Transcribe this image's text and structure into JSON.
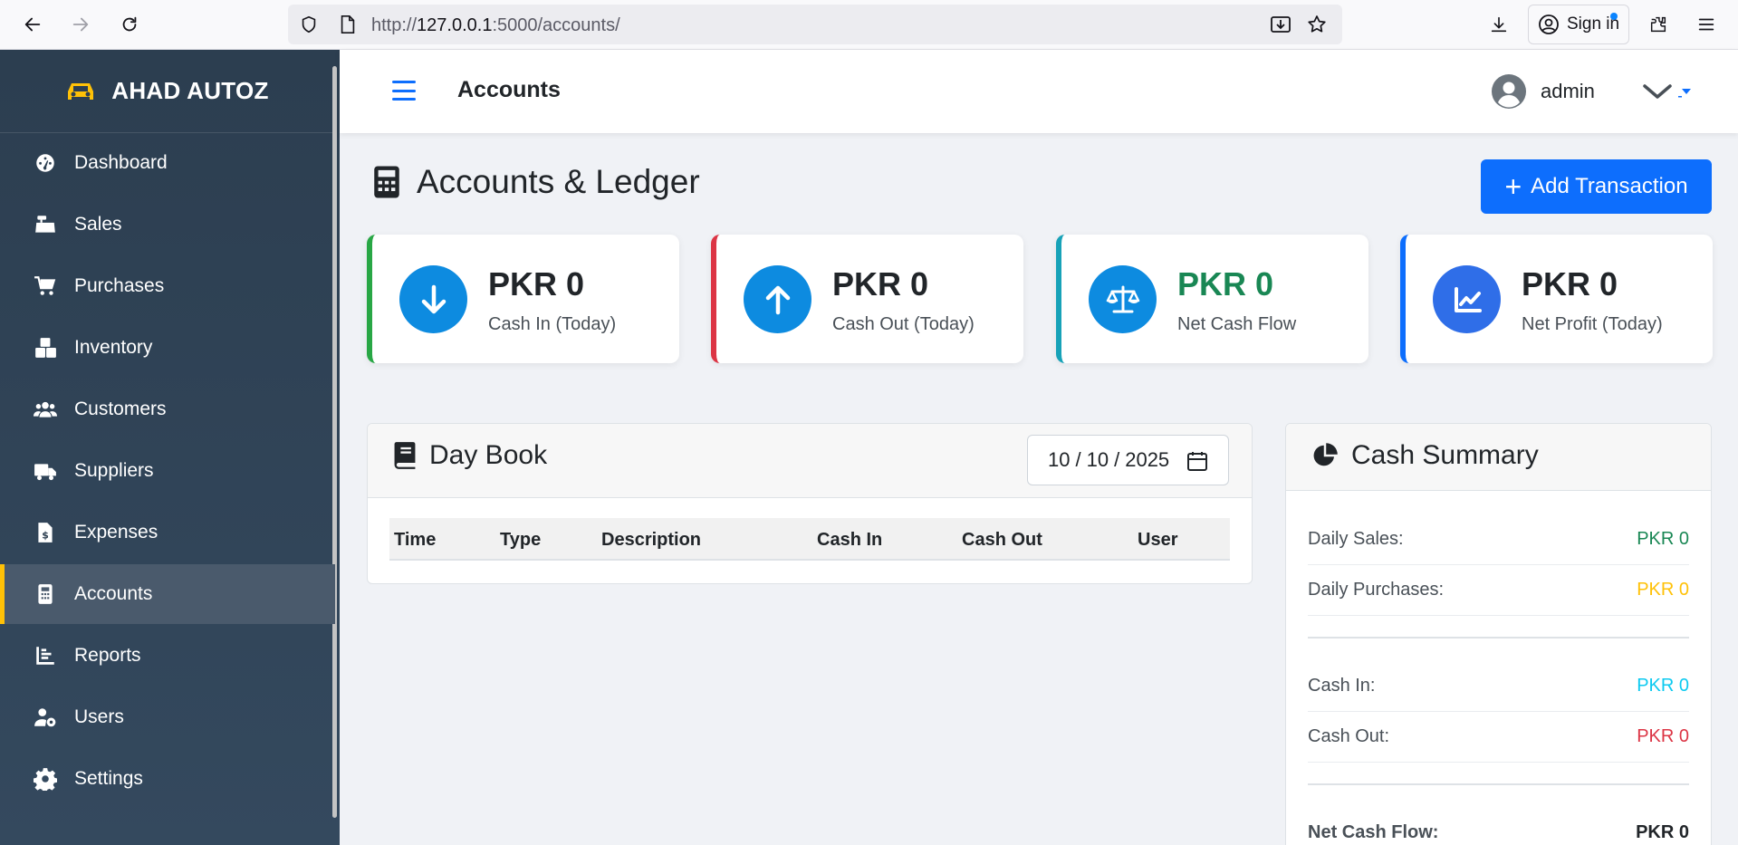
{
  "browser": {
    "url_prefix": "http://",
    "url_host": "127.0.0.1",
    "url_rest": ":5000/accounts/",
    "sign_in_label": "Sign in"
  },
  "sidebar": {
    "brand": "AHAD AUTOZ",
    "items": [
      {
        "label": "Dashboard",
        "icon": "dashboard-gauge-icon"
      },
      {
        "label": "Sales",
        "icon": "cash-register-icon"
      },
      {
        "label": "Purchases",
        "icon": "cart-icon"
      },
      {
        "label": "Inventory",
        "icon": "boxes-icon"
      },
      {
        "label": "Customers",
        "icon": "users-icon"
      },
      {
        "label": "Suppliers",
        "icon": "truck-icon"
      },
      {
        "label": "Expenses",
        "icon": "invoice-dollar-icon"
      },
      {
        "label": "Accounts",
        "icon": "calculator-icon",
        "active": true
      },
      {
        "label": "Reports",
        "icon": "bar-chart-icon"
      },
      {
        "label": "Users",
        "icon": "user-gear-icon"
      },
      {
        "label": "Settings",
        "icon": "gear-icon"
      }
    ]
  },
  "header": {
    "title": "Accounts",
    "user": "admin"
  },
  "main": {
    "heading": "Accounts & Ledger",
    "add_button": "Add Transaction",
    "stats": [
      {
        "value": "PKR 0",
        "label": "Cash In (Today)",
        "accent": "#28a745",
        "value_color": "#212529"
      },
      {
        "value": "PKR 0",
        "label": "Cash Out (Today)",
        "accent": "#dc3545",
        "value_color": "#212529"
      },
      {
        "value": "PKR 0",
        "label": "Net Cash Flow",
        "accent": "#17a2b8",
        "value_color": "#198754"
      },
      {
        "value": "PKR 0",
        "label": "Net Profit (Today)",
        "accent": "#0d6efd",
        "value_color": "#212529"
      }
    ],
    "daybook": {
      "title": "Day Book",
      "date": {
        "mm": "10",
        "dd": "10",
        "yyyy": "2025"
      },
      "columns": [
        "Time",
        "Type",
        "Description",
        "Cash In",
        "Cash Out",
        "User"
      ]
    },
    "cash_summary": {
      "title": "Cash Summary",
      "rows": [
        {
          "label": "Daily Sales:",
          "value": "PKR 0",
          "color": "#198754"
        },
        {
          "label": "Daily Purchases:",
          "value": "PKR 0",
          "color": "#ffc107"
        },
        {
          "label": "Cash In:",
          "value": "PKR 0",
          "color": "#0dcaf0"
        },
        {
          "label": "Cash Out:",
          "value": "PKR 0",
          "color": "#dc3545"
        }
      ],
      "net_label": "Net Cash Flow:",
      "net_value": "PKR 0"
    }
  }
}
